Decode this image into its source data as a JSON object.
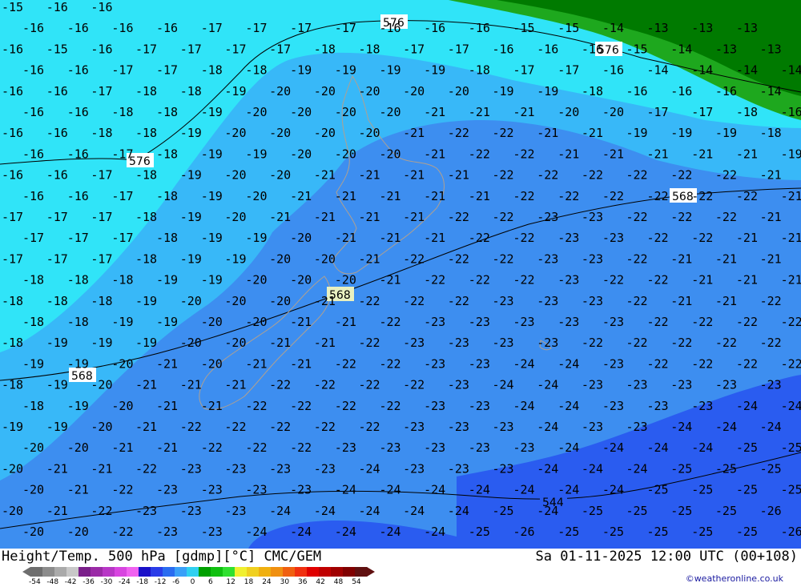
{
  "footer": {
    "title_left": "Height/Temp. 500 hPa [gdmp][°C] CMC/GEM",
    "title_right": "Sa 01-11-2025 12:00 UTC (00+108)",
    "credit": "©weatheronline.co.uk"
  },
  "color_scale": {
    "labels": [
      "-54",
      "-48",
      "-42",
      "-36",
      "-30",
      "-24",
      "-18",
      "-12",
      "-6",
      "0",
      "6",
      "12",
      "18",
      "24",
      "30",
      "36",
      "42",
      "48",
      "54"
    ],
    "colors": [
      "#6e6e6e",
      "#8c8c8c",
      "#aaaaaa",
      "#c8c8c8",
      "#7a1f8a",
      "#9a2aa6",
      "#b837c6",
      "#d845e0",
      "#f062f0",
      "#1a10c8",
      "#2a3ce8",
      "#2a6cf0",
      "#3aa0f8",
      "#30d0f0",
      "#00a000",
      "#10c010",
      "#30e030",
      "#f0f030",
      "#f0d020",
      "#f0b010",
      "#f09010",
      "#f06010",
      "#f03010",
      "#e00000",
      "#c00000",
      "#a00000",
      "#800000",
      "#601010"
    ]
  },
  "region_colors": {
    "deep_blue": "#2a5cf0",
    "mid_blue": "#3d8ef0",
    "light_blue": "#38b8f8",
    "cyan": "#30e4f8",
    "green_dark": "#007a00",
    "green": "#1ea81e",
    "land_outline": "#b0a090"
  },
  "contours": [
    {
      "label": "576"
    },
    {
      "label": "568"
    },
    {
      "label": "544"
    }
  ],
  "temperature_rows": [
    {
      "values": [
        "-15",
        "-16",
        "-16"
      ]
    },
    {
      "values": [
        "-16",
        "-16",
        "-16",
        "-16",
        "-17",
        "-17",
        "-17",
        "-17",
        "-16",
        "-16",
        "-16",
        "-15",
        "-15",
        "-14",
        "-13",
        "-13",
        "-13"
      ]
    },
    {
      "values": [
        "-16",
        "-15",
        "-16",
        "-17",
        "-17",
        "-17",
        "-17",
        "-18",
        "-18",
        "-17",
        "-17",
        "-16",
        "-16",
        "-16",
        "-15",
        "-14",
        "-13",
        "-13",
        "-13"
      ]
    },
    {
      "values": [
        "-16",
        "-16",
        "-17",
        "-17",
        "-18",
        "-18",
        "-19",
        "-19",
        "-19",
        "-19",
        "-18",
        "-17",
        "-17",
        "-16",
        "-14",
        "-14",
        "-14",
        "-14"
      ]
    },
    {
      "values": [
        "-16",
        "-16",
        "-17",
        "-18",
        "-18",
        "-19",
        "-20",
        "-20",
        "-20",
        "-20",
        "-20",
        "-19",
        "-19",
        "-18",
        "-16",
        "-16",
        "-16",
        "-14"
      ]
    },
    {
      "values": [
        "-16",
        "-16",
        "-18",
        "-18",
        "-19",
        "-20",
        "-20",
        "-20",
        "-20",
        "-21",
        "-21",
        "-21",
        "-20",
        "-20",
        "-17",
        "-17",
        "-18",
        "-16"
      ]
    },
    {
      "values": [
        "-16",
        "-16",
        "-18",
        "-18",
        "-19",
        "-20",
        "-20",
        "-20",
        "-20",
        "-21",
        "-22",
        "-22",
        "-21",
        "-21",
        "-19",
        "-19",
        "-19",
        "-18"
      ]
    },
    {
      "values": [
        "-16",
        "-16",
        "-17",
        "-18",
        "-19",
        "-19",
        "-20",
        "-20",
        "-20",
        "-21",
        "-22",
        "-22",
        "-21",
        "-21",
        "-21",
        "-21",
        "-21",
        "-19"
      ]
    },
    {
      "values": [
        "-16",
        "-16",
        "-17",
        "-18",
        "-19",
        "-20",
        "-20",
        "-21",
        "-21",
        "-21",
        "-21",
        "-22",
        "-22",
        "-22",
        "-22",
        "-22",
        "-22",
        "-21"
      ]
    },
    {
      "values": [
        "-16",
        "-16",
        "-17",
        "-18",
        "-19",
        "-20",
        "-21",
        "-21",
        "-21",
        "-21",
        "-21",
        "-22",
        "-22",
        "-22",
        "-22",
        "-22",
        "-22",
        "-21"
      ]
    },
    {
      "values": [
        "-17",
        "-17",
        "-17",
        "-18",
        "-19",
        "-20",
        "-21",
        "-21",
        "-21",
        "-21",
        "-22",
        "-22",
        "-23",
        "-23",
        "-22",
        "-22",
        "-22",
        "-21"
      ]
    },
    {
      "values": [
        "-17",
        "-17",
        "-17",
        "-18",
        "-19",
        "-19",
        "-20",
        "-21",
        "-21",
        "-21",
        "-22",
        "-22",
        "-23",
        "-23",
        "-22",
        "-22",
        "-21",
        "-21"
      ]
    },
    {
      "values": [
        "-17",
        "-17",
        "-17",
        "-18",
        "-19",
        "-19",
        "-20",
        "-20",
        "-21",
        "-22",
        "-22",
        "-22",
        "-23",
        "-23",
        "-22",
        "-21",
        "-21",
        "-21"
      ]
    },
    {
      "values": [
        "-18",
        "-18",
        "-18",
        "-19",
        "-19",
        "-20",
        "-20",
        "-20",
        "-21",
        "-22",
        "-22",
        "-22",
        "-23",
        "-22",
        "-22",
        "-21",
        "-21",
        "-21"
      ]
    },
    {
      "values": [
        "-18",
        "-18",
        "-18",
        "-19",
        "-20",
        "-20",
        "-20",
        "-21",
        "-22",
        "-22",
        "-22",
        "-23",
        "-23",
        "-23",
        "-22",
        "-21",
        "-21",
        "-22"
      ]
    },
    {
      "values": [
        "-18",
        "-18",
        "-19",
        "-19",
        "-20",
        "-20",
        "-21",
        "-21",
        "-22",
        "-23",
        "-23",
        "-23",
        "-23",
        "-23",
        "-22",
        "-22",
        "-22",
        "-22"
      ]
    },
    {
      "values": [
        "-18",
        "-19",
        "-19",
        "-19",
        "-20",
        "-20",
        "-21",
        "-21",
        "-22",
        "-23",
        "-23",
        "-23",
        "-23",
        "-22",
        "-22",
        "-22",
        "-22",
        "-22"
      ]
    },
    {
      "values": [
        "-19",
        "-19",
        "-20",
        "-21",
        "-20",
        "-21",
        "-21",
        "-22",
        "-22",
        "-23",
        "-23",
        "-24",
        "-24",
        "-23",
        "-22",
        "-22",
        "-22",
        "-22"
      ]
    },
    {
      "values": [
        "-18",
        "-19",
        "-20",
        "-21",
        "-21",
        "-21",
        "-22",
        "-22",
        "-22",
        "-22",
        "-23",
        "-24",
        "-24",
        "-23",
        "-23",
        "-23",
        "-23",
        "-23"
      ]
    },
    {
      "values": [
        "-18",
        "-19",
        "-20",
        "-21",
        "-21",
        "-22",
        "-22",
        "-22",
        "-22",
        "-23",
        "-23",
        "-24",
        "-24",
        "-23",
        "-23",
        "-23",
        "-24",
        "-24"
      ]
    },
    {
      "values": [
        "-19",
        "-19",
        "-20",
        "-21",
        "-22",
        "-22",
        "-22",
        "-22",
        "-22",
        "-23",
        "-23",
        "-23",
        "-24",
        "-23",
        "-23",
        "-24",
        "-24",
        "-24"
      ]
    },
    {
      "values": [
        "-20",
        "-20",
        "-21",
        "-21",
        "-22",
        "-22",
        "-22",
        "-23",
        "-23",
        "-23",
        "-23",
        "-23",
        "-24",
        "-24",
        "-24",
        "-24",
        "-25",
        "-25"
      ]
    },
    {
      "values": [
        "-20",
        "-21",
        "-21",
        "-22",
        "-23",
        "-23",
        "-23",
        "-23",
        "-24",
        "-23",
        "-23",
        "-23",
        "-24",
        "-24",
        "-24",
        "-25",
        "-25",
        "-25"
      ]
    },
    {
      "values": [
        "-20",
        "-21",
        "-22",
        "-23",
        "-23",
        "-23",
        "-23",
        "-24",
        "-24",
        "-24",
        "-24",
        "-24",
        "-24",
        "-24",
        "-25",
        "-25",
        "-25",
        "-25"
      ]
    },
    {
      "values": [
        "-20",
        "-21",
        "-22",
        "-23",
        "-23",
        "-23",
        "-24",
        "-24",
        "-24",
        "-24",
        "-24",
        "-25",
        "-24",
        "-25",
        "-25",
        "-25",
        "-25",
        "-26"
      ]
    },
    {
      "values": [
        "-20",
        "-20",
        "-22",
        "-23",
        "-23",
        "-24",
        "-24",
        "-24",
        "-24",
        "-24",
        "-25",
        "-26",
        "-25",
        "-25",
        "-25",
        "-25",
        "-25",
        "-26"
      ]
    }
  ]
}
